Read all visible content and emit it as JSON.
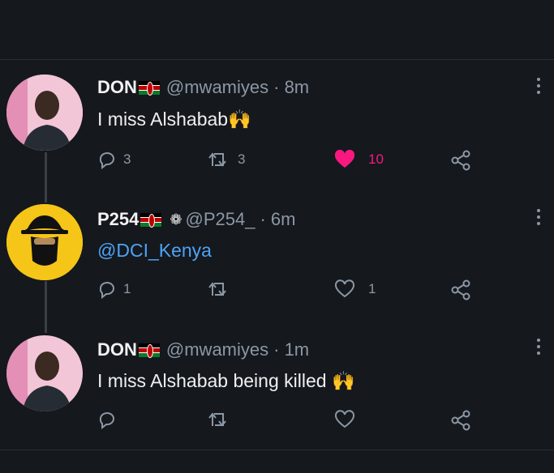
{
  "tweets": [
    {
      "name": "DON",
      "handle": "@mwamiyes",
      "time": "· 8m",
      "text": "I miss Alshabab",
      "emoji": "🙌",
      "replies": "3",
      "retweets": "3",
      "likes": "10",
      "liked": true
    },
    {
      "name": "P254",
      "handle": "@P254_",
      "time": "· 6m",
      "text": "@DCI_Kenya",
      "replies": "1",
      "retweets": "",
      "likes": "1",
      "liked": false
    },
    {
      "name": "DON",
      "handle": "@mwamiyes",
      "time": "· 1m",
      "text": "I miss Alshabab being killed",
      "emoji": "🙌",
      "replies": "",
      "retweets": "",
      "likes": "",
      "liked": false
    }
  ],
  "colors": {
    "background": "#15181d",
    "like_active": "#f91880",
    "mention": "#4da3f5",
    "muted": "#8b98a5"
  },
  "icons": [
    "reply-icon",
    "retweet-icon",
    "heart-icon",
    "share-icon",
    "more-icon",
    "kenya-flag-icon",
    "verified-flower-icon"
  ]
}
